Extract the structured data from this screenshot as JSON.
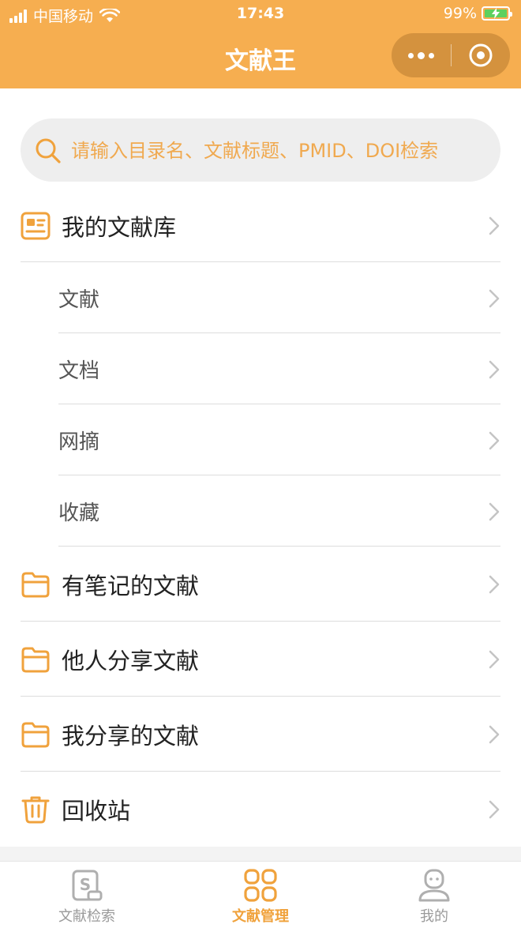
{
  "status_bar": {
    "carrier": "中国移动",
    "time": "17:43",
    "battery": "99%"
  },
  "nav": {
    "title": "文献王"
  },
  "search": {
    "placeholder": "请输入目录名、文献标题、PMID、DOI检索"
  },
  "menu": {
    "library": "我的文献库",
    "sub_items": [
      "文献",
      "文档",
      "网摘",
      "收藏"
    ],
    "noted": "有笔记的文献",
    "shared_by_others": "他人分享文献",
    "my_shared": "我分享的文献",
    "recycle": "回收站"
  },
  "tabs": [
    {
      "label": "文献检索",
      "active": false
    },
    {
      "label": "文献管理",
      "active": true
    },
    {
      "label": "我的",
      "active": false
    }
  ],
  "colors": {
    "accent": "#F6AE50",
    "icon": "#F0A23C"
  }
}
